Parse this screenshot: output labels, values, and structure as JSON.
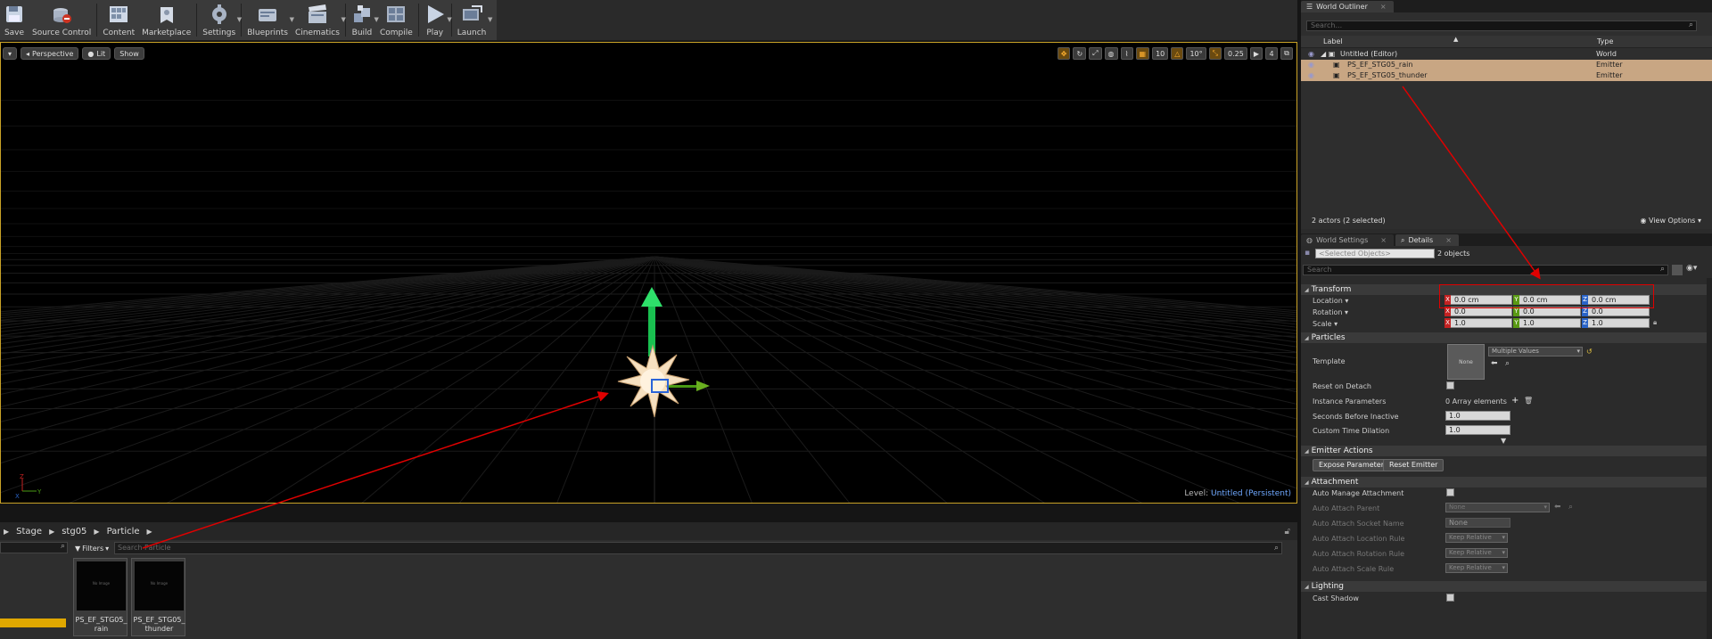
{
  "toolbar": {
    "buttons": [
      {
        "label": "Save",
        "icon": "save-icon"
      },
      {
        "label": "Source Control",
        "icon": "source-control-icon"
      },
      {
        "label": "Content",
        "icon": "content-icon"
      },
      {
        "label": "Marketplace",
        "icon": "marketplace-icon"
      },
      {
        "label": "Settings",
        "icon": "settings-icon"
      },
      {
        "label": "Blueprints",
        "icon": "blueprints-icon"
      },
      {
        "label": "Cinematics",
        "icon": "cinematics-icon"
      },
      {
        "label": "Build",
        "icon": "build-icon"
      },
      {
        "label": "Compile",
        "icon": "compile-icon"
      },
      {
        "label": "Play",
        "icon": "play-icon"
      },
      {
        "label": "Launch",
        "icon": "launch-icon"
      }
    ]
  },
  "viewport": {
    "view_mode": "Perspective",
    "lit": "Lit",
    "show": "Show",
    "grid_snap": "10",
    "rot_snap": "10°",
    "scale_snap": "0.25",
    "cam_speed": "4",
    "level_label": "Level:",
    "level_value": "Untitled (Persistent)",
    "axis_x": "X",
    "axis_y": "Y",
    "axis_z": "Z"
  },
  "content_browser": {
    "path": [
      "Stage",
      "stg05",
      "Particle"
    ],
    "filters": "Filters",
    "search_placeholder": "Search Particle",
    "assets": [
      {
        "name": "PS_EF_STG05_\nrain",
        "thumb": "No Image"
      },
      {
        "name": "PS_EF_STG05_\nthunder",
        "thumb": "No Image"
      }
    ]
  },
  "outliner": {
    "tab": "World Outliner",
    "search_placeholder": "Search...",
    "col_label": "Label",
    "col_type": "Type",
    "rows": [
      {
        "label": "Untitled (Editor)",
        "type": "World",
        "selected": false
      },
      {
        "label": "PS_EF_STG05_rain",
        "type": "Emitter",
        "selected": true
      },
      {
        "label": "PS_EF_STG05_thunder",
        "type": "Emitter",
        "selected": true
      }
    ],
    "footer_count": "2 actors (2 selected)",
    "view_options": "View Options"
  },
  "details": {
    "tab_world_settings": "World Settings",
    "tab_details": "Details",
    "selected_placeholder": "<Selected Objects>",
    "objects_count": "2 objects",
    "search_placeholder": "Search",
    "transform": {
      "title": "Transform",
      "location_label": "Location",
      "rotation_label": "Rotation",
      "scale_label": "Scale",
      "location": [
        "0.0 cm",
        "0.0 cm",
        "0.0 cm"
      ],
      "rotation": [
        "0.0",
        "0.0",
        "0.0"
      ],
      "scale": [
        "1.0",
        "1.0",
        "1.0"
      ]
    },
    "particles": {
      "title": "Particles",
      "template_label": "Template",
      "template_thumb": "None",
      "template_value": "Multiple Values",
      "reset_on_detach": "Reset on Detach",
      "instance_params": "Instance Parameters",
      "instance_params_value": "0 Array elements",
      "seconds_before_inactive": "Seconds Before Inactive",
      "seconds_value": "1.0",
      "custom_time_dilation": "Custom Time Dilation",
      "dilation_value": "1.0"
    },
    "emitter_actions": {
      "title": "Emitter Actions",
      "expose": "Expose Parameter",
      "reset": "Reset Emitter"
    },
    "attachment": {
      "title": "Attachment",
      "auto_manage": "Auto Manage Attachment",
      "auto_parent": "Auto Attach Parent",
      "auto_parent_value": "None",
      "socket_name": "Auto Attach Socket Name",
      "socket_value": "None",
      "location_rule": "Auto Attach Location Rule",
      "rotation_rule": "Auto Attach Rotation Rule",
      "scale_rule": "Auto Attach Scale Rule",
      "rule_value": "Keep Relative"
    },
    "lighting": {
      "title": "Lighting",
      "cast_shadow": "Cast Shadow"
    }
  },
  "colors": {
    "selection": "#c8a683",
    "viewport_border": "#c9a227",
    "annotation": "#e00000"
  }
}
